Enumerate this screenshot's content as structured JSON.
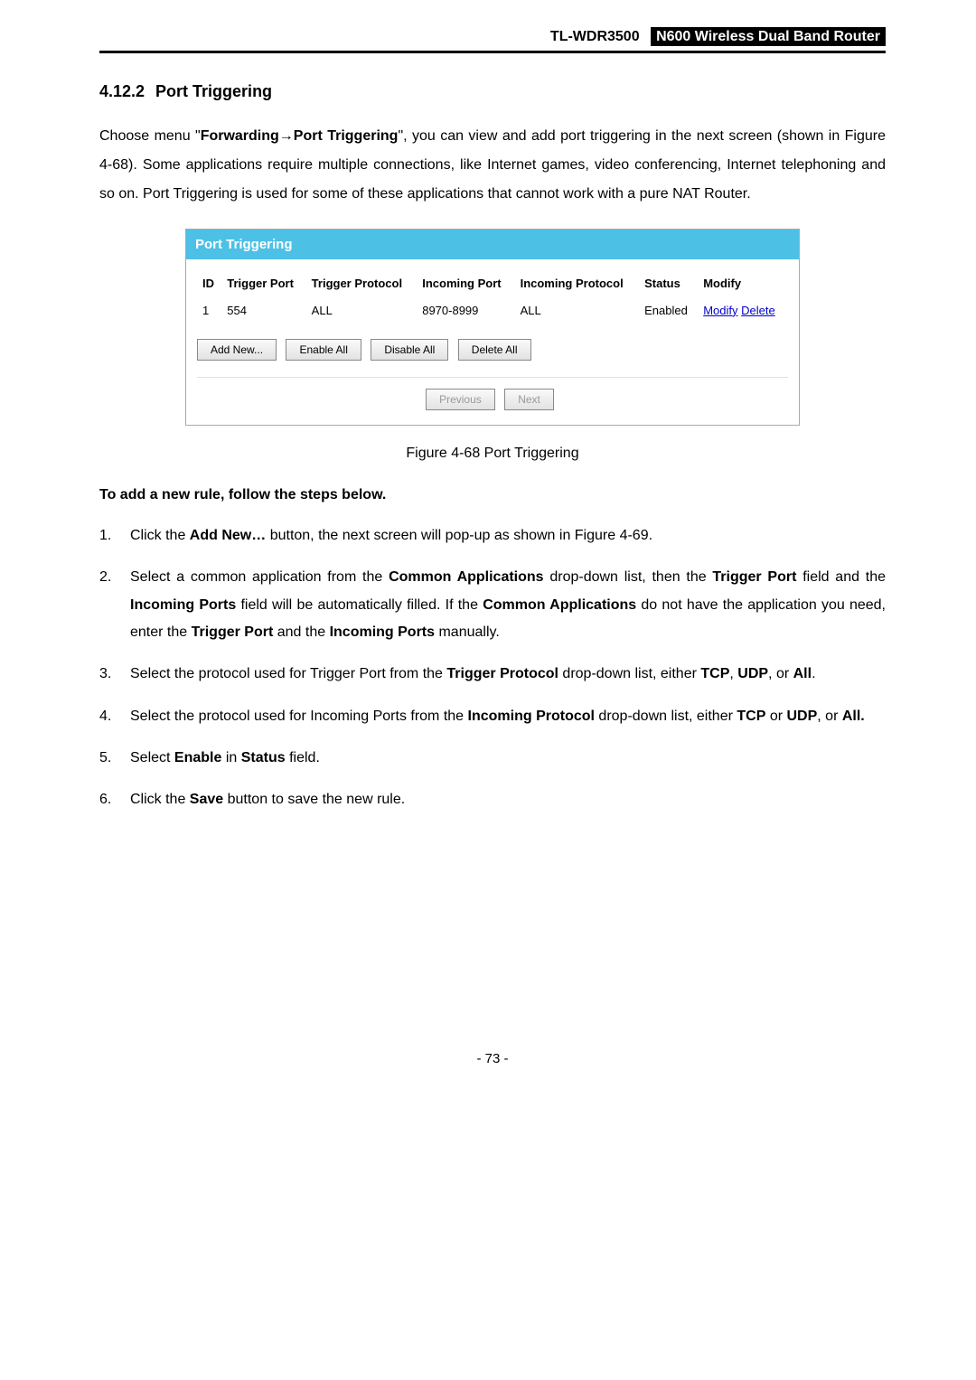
{
  "header": {
    "model": "TL-WDR3500",
    "product": "N600 Wireless Dual Band Router"
  },
  "section": {
    "number": "4.12.2",
    "title": "Port Triggering"
  },
  "intro": {
    "pre": "Choose menu \"",
    "bold1": "Forwarding",
    "arrow": "→",
    "bold2": "Port Triggering",
    "post": "\", you can view and add port triggering in the next screen (shown in Figure 4-68). Some applications require multiple connections, like Internet games, video conferencing, Internet telephoning and so on. Port Triggering is used for some of these applications that cannot work with a pure NAT Router."
  },
  "panel": {
    "title": "Port Triggering",
    "headers": {
      "id": "ID",
      "trigger_port": "Trigger Port",
      "trigger_protocol": "Trigger Protocol",
      "incoming_port": "Incoming Port",
      "incoming_protocol": "Incoming Protocol",
      "status": "Status",
      "modify": "Modify"
    },
    "row": {
      "id": "1",
      "trigger_port": "554",
      "trigger_protocol": "ALL",
      "incoming_port": "8970-8999",
      "incoming_protocol": "ALL",
      "status": "Enabled",
      "modify": "Modify",
      "delete": "Delete"
    },
    "buttons": {
      "add_new": "Add New...",
      "enable_all": "Enable All",
      "disable_all": "Disable All",
      "delete_all": "Delete All",
      "previous": "Previous",
      "next": "Next"
    }
  },
  "figure_caption": "Figure 4-68 Port Triggering",
  "subheading": "To add a new rule, follow the steps below.",
  "steps": {
    "s1": {
      "num": "1.",
      "pre": "Click the ",
      "b1": "Add New…",
      "post": " button, the next screen will pop-up as shown in Figure 4-69."
    },
    "s2": {
      "num": "2.",
      "p1": "Select a common application from the ",
      "b1": "Common Applications",
      "p2": " drop-down list, then the ",
      "b2": "Trigger Port",
      "p3": " field and the ",
      "b3": "Incoming Ports",
      "p4": " field will be automatically filled. If the ",
      "b4": "Common Applications",
      "p5": " do not have the application you need, enter the ",
      "b5": "Trigger Port",
      "p6": " and the ",
      "b6": "Incoming Ports",
      "p7": " manually."
    },
    "s3": {
      "num": "3.",
      "p1": "Select the protocol used for Trigger Port from the ",
      "b1": "Trigger Protocol",
      "p2": " drop-down list, either ",
      "b2": "TCP",
      "p3": ", ",
      "b3": "UDP",
      "p4": ", or ",
      "b4": "All",
      "p5": "."
    },
    "s4": {
      "num": "4.",
      "p1": "Select the protocol used for Incoming Ports from the ",
      "b1": "Incoming Protocol",
      "p2": " drop-down list, either ",
      "b2": "TCP",
      "p3": " or ",
      "b3": "UDP",
      "p4": ", or ",
      "b4": "All.",
      "p5": ""
    },
    "s5": {
      "num": "5.",
      "p1": "Select ",
      "b1": "Enable",
      "p2": " in ",
      "b2": "Status",
      "p3": " field."
    },
    "s6": {
      "num": "6.",
      "p1": "Click the ",
      "b1": "Save",
      "p2": " button to save the new rule."
    }
  },
  "page_number": "- 73 -"
}
